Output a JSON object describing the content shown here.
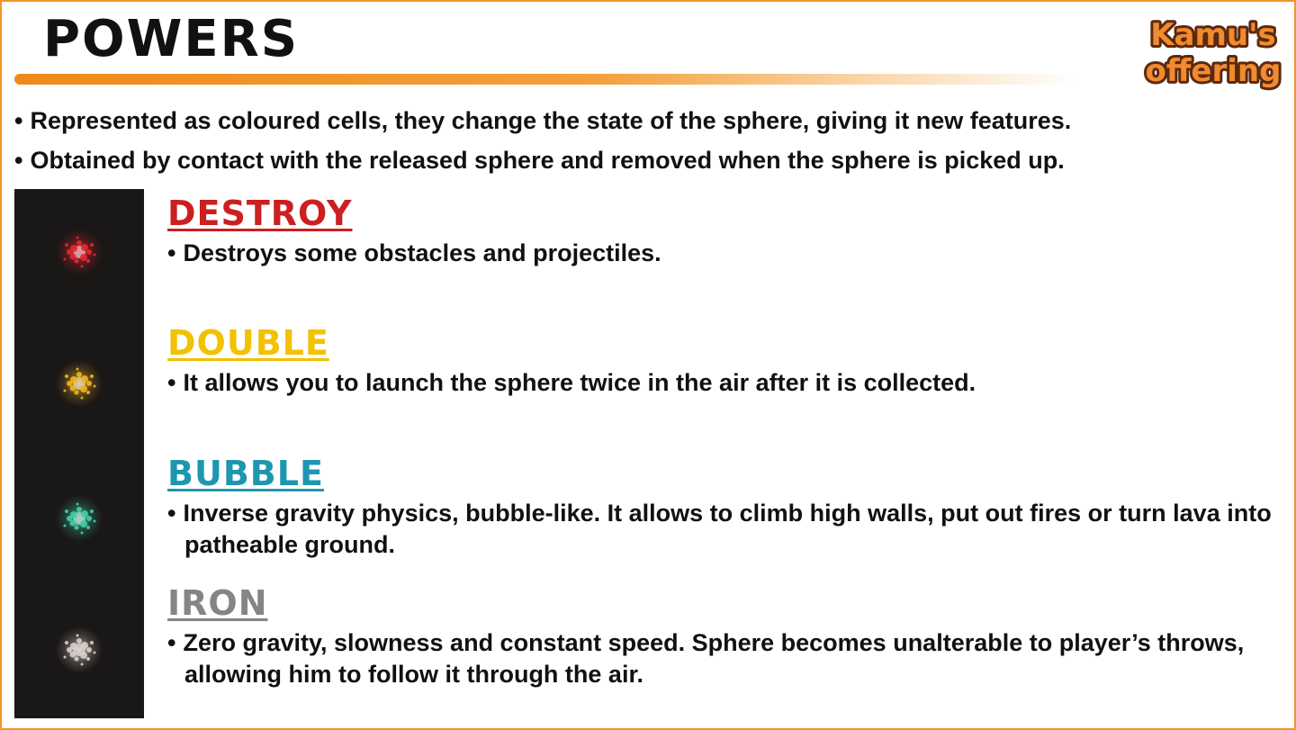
{
  "page": {
    "title": "POWERS",
    "logo": {
      "line1": "Kamu's",
      "line2": "offering"
    },
    "bullet": "•"
  },
  "intro": [
    "Represented as coloured cells, they change the state of the sphere, giving it new features.",
    "Obtained by contact with the released sphere and removed when the sphere is picked up."
  ],
  "powers": [
    {
      "name": "DESTROY",
      "color": "#cc1f1f",
      "orb_color": "#e8262f",
      "description": "Destroys some obstacles and projectiles."
    },
    {
      "name": "DOUBLE",
      "color": "#f2c100",
      "orb_color": "#f2b51e",
      "description": "It allows you to launch the sphere twice in the air after it is collected."
    },
    {
      "name": "BUBBLE",
      "color": "#1d97b0",
      "orb_color": "#3fd0a9",
      "description": "Inverse gravity physics, bubble-like. It allows to climb high walls, put out fires or turn lava into patheable ground."
    },
    {
      "name": "IRON",
      "color": "#858585",
      "orb_color": "#d9cfc8",
      "description": "Zero gravity, slowness and constant speed. Sphere becomes unalterable to player’s throws, allowing him to follow it through the air."
    }
  ],
  "colors": {
    "accent_orange": "#f0962a",
    "text": "#111111",
    "strip_background": "#1a1717"
  }
}
